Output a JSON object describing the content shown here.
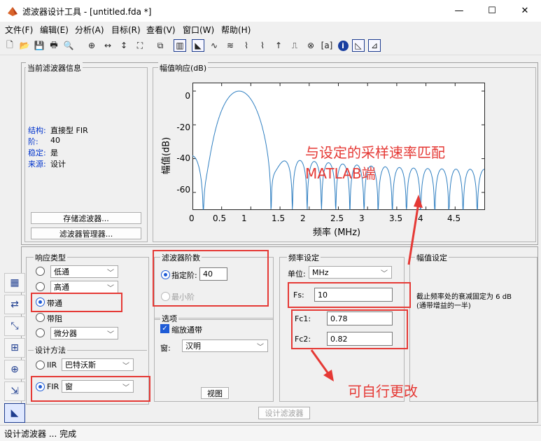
{
  "window": {
    "title": "滤波器设计工具 - [untitled.fda *]",
    "minimize": "—",
    "maximize": "☐",
    "close": "✕"
  },
  "menu": [
    "文件(F)",
    "编辑(E)",
    "分析(A)",
    "目标(R)",
    "查看(V)",
    "窗口(W)",
    "帮助(H)"
  ],
  "filter_info": {
    "title": "当前滤波器信息",
    "rows": [
      {
        "label": "结构:",
        "value": "直接型 FIR"
      },
      {
        "label": "阶:",
        "value": "40"
      },
      {
        "label": "稳定:",
        "value": "是"
      },
      {
        "label": "来源:",
        "value": "设计"
      }
    ],
    "store_button": "存储滤波器...",
    "manager_button": "滤波器管理器..."
  },
  "plot": {
    "title": "幅值响应(dB)",
    "xlabel": "频率 (MHz)",
    "ylabel": "幅值(dB)",
    "xticks": [
      "0",
      "0.5",
      "1",
      "1.5",
      "2",
      "2.5",
      "3",
      "3.5",
      "4",
      "4.5"
    ],
    "yticks": [
      "0",
      "-20",
      "-40",
      "-60"
    ]
  },
  "chart_data": {
    "type": "line",
    "xlabel": "频率 (MHz)",
    "ylabel": "幅值(dB)",
    "xlim": [
      0,
      5
    ],
    "ylim": [
      -70,
      5
    ],
    "line_color": "#2f7fc1",
    "grid": false
  },
  "response_type": {
    "title": "响应类型",
    "options": [
      {
        "label": "",
        "select": "低通"
      },
      {
        "label": "",
        "select": "高通"
      },
      {
        "label": "带通",
        "select": ""
      },
      {
        "label": "带阻",
        "select": ""
      },
      {
        "label": "",
        "select": "微分器"
      }
    ]
  },
  "design_method": {
    "title": "设计方法",
    "iir_label": "IIR",
    "iir_select": "巴特沃斯",
    "fir_label": "FIR",
    "fir_select": "窗"
  },
  "filter_order": {
    "title": "滤波器阶数",
    "specify_label": "指定阶:",
    "specify_value": "40",
    "min_label": "最小阶"
  },
  "options": {
    "title": "选项",
    "scale_label": "缩放通带",
    "window_label": "窗:",
    "window_value": "汉明",
    "view_button": "视图"
  },
  "freq_spec": {
    "title": "频率设定",
    "unit_label": "单位:",
    "unit_value": "MHz",
    "fs_label": "Fs:",
    "fs_value": "10",
    "fc1_label": "Fc1:",
    "fc1_value": "0.78",
    "fc2_label": "Fc2:",
    "fc2_value": "0.82"
  },
  "mag_spec": {
    "title": "幅值设定",
    "note_line1": "截止频率处的衰减固定为 6 dB",
    "note_line2": "(通带增益的一半)"
  },
  "design_button": "设计滤波器",
  "annotations": {
    "top_line1": "与设定的采样速率匹配",
    "top_line2": "MATLAB端",
    "bottom": "可自行更改"
  },
  "status": "设计滤波器 ... 完成",
  "colors": {
    "highlight": "#e53935",
    "accent": "#1e5bd6"
  }
}
